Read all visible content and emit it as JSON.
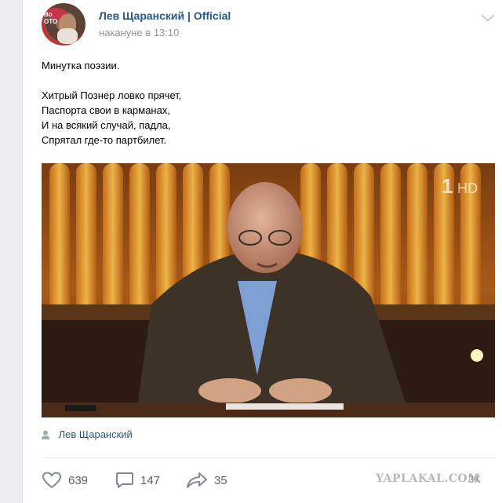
{
  "post": {
    "author": "Лев Щаранский | Official",
    "time": "накануне в 13:10",
    "lines": [
      "Минутка поэзии.",
      "",
      "Хитрый Познер ловко прячет,",
      "Паспорта свои в карманах,",
      "И на всякий случай, падла,",
      "Спрятал где-то партбилет."
    ],
    "photo": {
      "tv_logo": "1",
      "tv_hd": "HD"
    },
    "source_author": "Лев Щаранский",
    "likes": "639",
    "comments": "147",
    "shares": "35",
    "views_suffix": "3K"
  },
  "watermark": "YAPLAKAL.COM",
  "colors": {
    "link": "#2a5885",
    "meta": "#939393",
    "action": "#5d5f61"
  },
  "icons": [
    "chevron-down-icon",
    "user-icon",
    "heart-icon",
    "comment-icon",
    "share-icon"
  ]
}
